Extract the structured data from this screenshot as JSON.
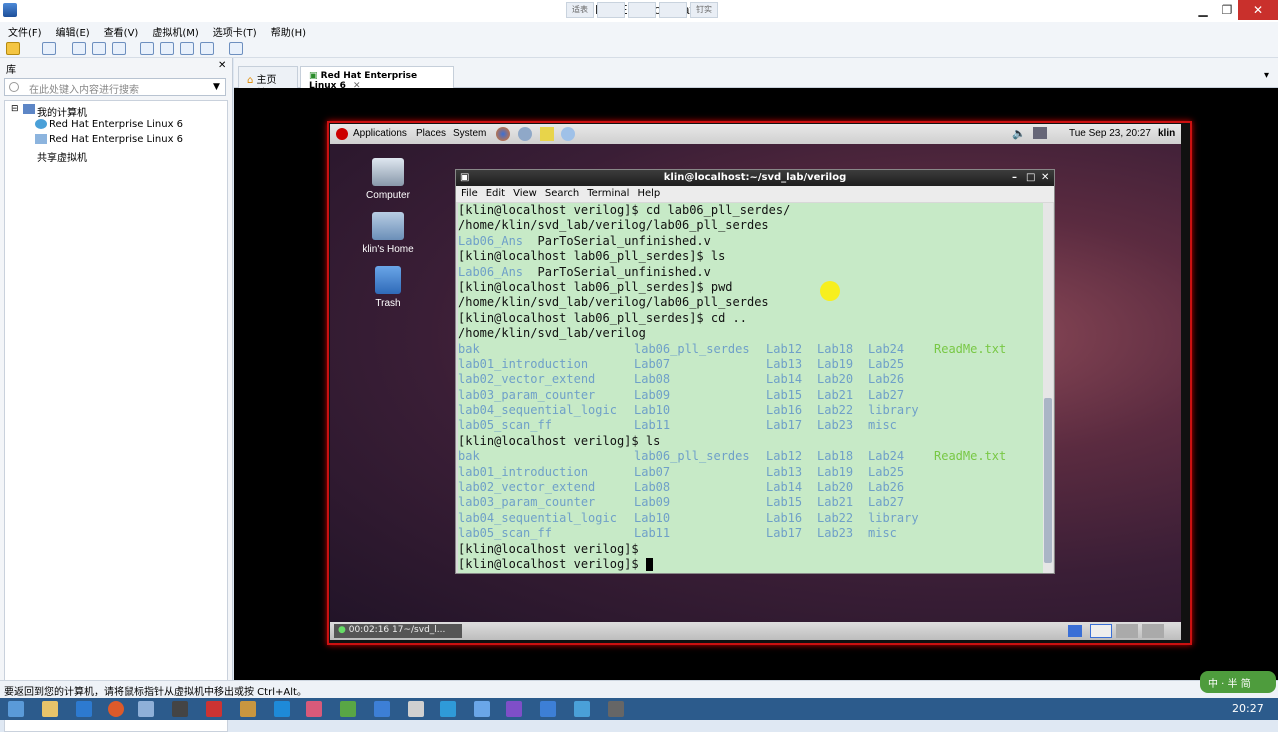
{
  "window": {
    "title": "Red Hat Ent        Workstation",
    "mini": [
      "适表",
      "",
      "",
      "",
      "钉实"
    ]
  },
  "menu": [
    "文件(F)",
    "编辑(E)",
    "查看(V)",
    "虚拟机(M)",
    "选项卡(T)",
    "帮助(H)"
  ],
  "library": {
    "title": "库",
    "search_placeholder": "在此处键入内容进行搜索",
    "my_computer": "我的计算机",
    "vm1": "Red Hat Enterprise Linux 6",
    "vm2": "Red Hat Enterprise Linux 6",
    "shared": "共享虚拟机"
  },
  "tabs": {
    "home": "主页",
    "vm": "Red Hat Enterprise Linux 6"
  },
  "gnome": {
    "applications": "Applications",
    "places": "Places",
    "system": "System",
    "datetime": "Tue Sep 23, 20:27",
    "user": "klin"
  },
  "desktop": {
    "computer": "Computer",
    "home": "klin's Home",
    "trash": "Trash"
  },
  "terminal": {
    "title": "klin@localhost:~/svd_lab/verilog",
    "menu": [
      "File",
      "Edit",
      "View",
      "Search",
      "Terminal",
      "Help"
    ],
    "lines": [
      {
        "t": "[klin@localhost verilog]$ cd lab06_pll_serdes/"
      },
      {
        "t": "/home/klin/svd_lab/verilog/lab06_pll_serdes"
      },
      {
        "blue": "Lab06_Ans",
        "t": "  ParToSerial_unfinished.v"
      },
      {
        "t": "[klin@localhost lab06_pll_serdes]$ ls"
      },
      {
        "blue": "Lab06_Ans",
        "t": "  ParToSerial_unfinished.v"
      },
      {
        "t": "[klin@localhost lab06_pll_serdes]$ pwd"
      },
      {
        "t": "/home/klin/svd_lab/verilog/lab06_pll_serdes"
      },
      {
        "t": "[klin@localhost lab06_pll_serdes]$ cd .."
      },
      {
        "t": "/home/klin/svd_lab/verilog"
      }
    ],
    "ls1": [
      [
        "bak",
        "lab06_pll_serdes",
        "Lab12",
        "Lab18",
        "Lab24",
        "ReadMe.txt"
      ],
      [
        "lab01_introduction",
        "Lab07",
        "Lab13",
        "Lab19",
        "Lab25",
        ""
      ],
      [
        "lab02_vector_extend",
        "Lab08",
        "Lab14",
        "Lab20",
        "Lab26",
        ""
      ],
      [
        "lab03_param_counter",
        "Lab09",
        "Lab15",
        "Lab21",
        "Lab27",
        ""
      ],
      [
        "lab04_sequential_logic",
        "Lab10",
        "Lab16",
        "Lab22",
        "library",
        ""
      ],
      [
        "lab05_scan_ff",
        "Lab11",
        "Lab17",
        "Lab23",
        "misc",
        ""
      ]
    ],
    "mid": "[klin@localhost verilog]$ ls",
    "end1": "[klin@localhost verilog]$",
    "end2": "[klin@localhost verilog]$ "
  },
  "guest_bottom": {
    "timer": "00:02:16",
    "task": "17~/svd_l..."
  },
  "statusbar": "要返回到您的计算机，请将鼠标指针从虚拟机中移出或按 Ctrl+Alt。",
  "clock": "20:27",
  "ime": "中 · 半 简"
}
